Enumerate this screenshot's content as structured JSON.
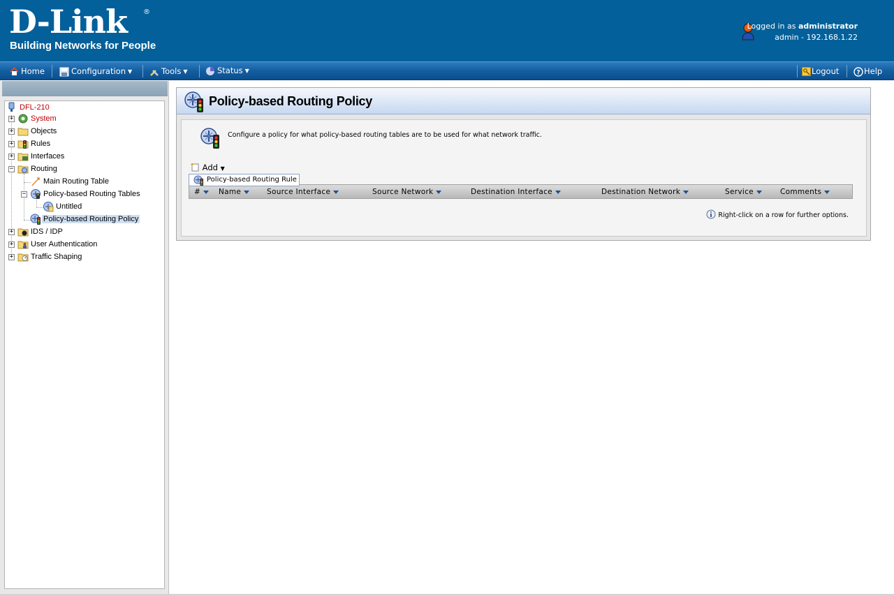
{
  "header": {
    "brand": "D-Link",
    "brand_mark": "®",
    "tagline": "Building Networks for People",
    "logged_in_prefix": "Logged in as",
    "user": "administrator",
    "session": "admin - 192.168.1.22"
  },
  "menu": {
    "home": "Home",
    "configuration": "Configuration",
    "tools": "Tools",
    "status": "Status",
    "logout": "Logout",
    "help": "Help"
  },
  "tree": {
    "root": "DFL-210",
    "items": [
      {
        "label": "System"
      },
      {
        "label": "Objects"
      },
      {
        "label": "Rules"
      },
      {
        "label": "Interfaces"
      },
      {
        "label": "Routing"
      },
      {
        "label": "Main Routing Table"
      },
      {
        "label": "Policy-based Routing Tables"
      },
      {
        "label": "Untitled"
      },
      {
        "label": "Policy-based Routing Policy"
      },
      {
        "label": "IDS / IDP"
      },
      {
        "label": "User Authentication"
      },
      {
        "label": "Traffic Shaping"
      }
    ]
  },
  "page": {
    "title": "Policy-based Routing Policy",
    "description": "Configure a policy for what policy-based routing tables are to be used for what network traffic.",
    "add_label": "Add",
    "add_menu_item": "Policy-based Routing Rule",
    "columns": [
      "#",
      "Name",
      "Source Interface",
      "Source Network",
      "Destination Interface",
      "Destination Network",
      "Service",
      "Comments"
    ],
    "hint": "Right-click on a row for further options."
  },
  "colors": {
    "header_bg": "#03609a",
    "menubar_bg": "#135e9f",
    "selected_bg": "#cfdff1",
    "alert_red": "#c00000"
  }
}
